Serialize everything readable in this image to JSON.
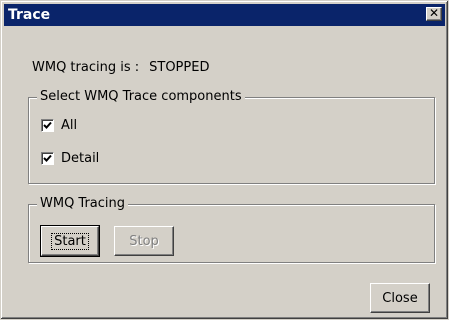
{
  "window": {
    "title": "Trace",
    "close_glyph": "✕"
  },
  "status": {
    "label": "WMQ tracing is :",
    "value": "STOPPED"
  },
  "components": {
    "legend": "Select WMQ Trace components",
    "items": [
      {
        "label": "All",
        "checked": true
      },
      {
        "label": "Detail",
        "checked": true
      }
    ]
  },
  "tracing": {
    "legend": "WMQ Tracing",
    "start_label": "Start",
    "stop_label": "Stop"
  },
  "footer": {
    "close_label": "Close"
  },
  "colors": {
    "titlebar": "#0a246a",
    "face": "#d4d0c8"
  },
  "icons": {
    "check": "check-icon",
    "close": "close-icon"
  }
}
